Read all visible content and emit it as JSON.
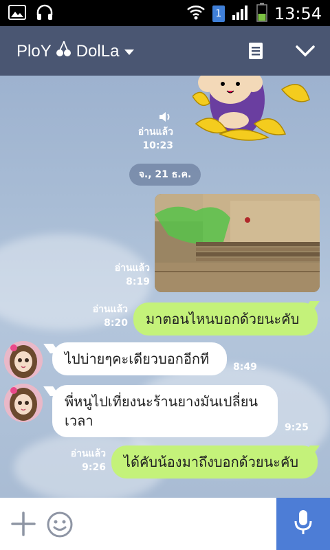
{
  "status_bar": {
    "time": "13:54",
    "sim_badge": "1"
  },
  "header": {
    "title": "PloY",
    "title_suffix": "DolLa"
  },
  "chat": {
    "sticker_read": {
      "label": "อ่านแล้ว",
      "time": "10:23"
    },
    "date_divider": "จ., 21 ธ.ค.",
    "photo_read": {
      "label": "อ่านแล้ว",
      "time": "8:19"
    },
    "messages": [
      {
        "direction": "out",
        "text": "มาตอนไหนบอกด้วยนะคับ",
        "read_label": "อ่านแล้ว",
        "time": "8:20"
      },
      {
        "direction": "in",
        "text": "ไปบ่ายๆคะเดียวบอกอีกที",
        "time": "8:49"
      },
      {
        "direction": "in",
        "text": "พี่หนูไปเที่ยงนะร้านยางมันเปลี่ยนเวลา",
        "time": "9:25"
      },
      {
        "direction": "out",
        "text": "ได้คับน้องมาถึงบอกด้วยนะคับ",
        "read_label": "อ่านแล้ว",
        "time": "9:26"
      }
    ]
  },
  "colors": {
    "header": "#4a5672",
    "outgoing_bubble": "#c4f27a",
    "mic_button": "#4d7dd6"
  }
}
